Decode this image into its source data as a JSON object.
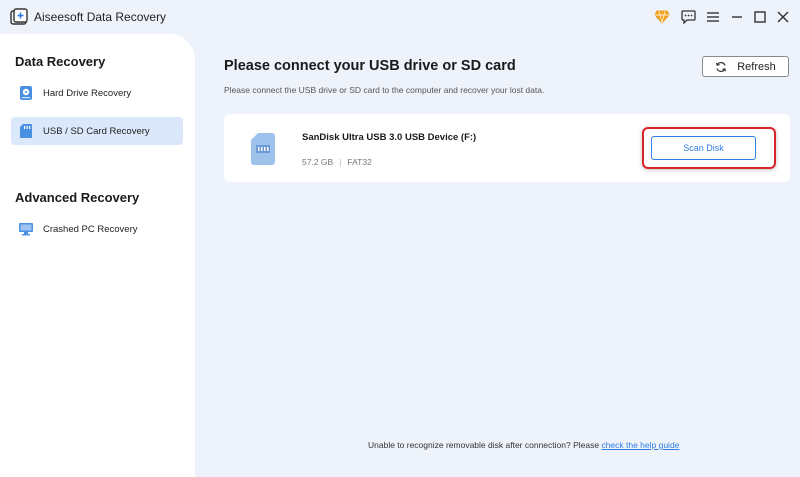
{
  "titlebar": {
    "app_title": "Aiseesoft Data Recovery",
    "icons": [
      "app-logo-icon",
      "diamond-icon",
      "feedback-icon",
      "menu-icon",
      "minimize-icon",
      "maximize-icon",
      "close-icon"
    ]
  },
  "sidebar": {
    "section1_title": "Data Recovery",
    "items": [
      {
        "label": "Hard Drive Recovery",
        "icon": "hard-drive-icon"
      },
      {
        "label": "USB / SD Card Recovery",
        "icon": "sd-card-icon",
        "active": true
      }
    ],
    "section2_title": "Advanced Recovery",
    "items2": [
      {
        "label": "Crashed PC Recovery",
        "icon": "pc-icon"
      }
    ]
  },
  "main": {
    "title": "Please connect your USB drive or SD card",
    "subtitle": "Please connect the USB drive or SD card to the computer and recover your lost data.",
    "refresh_label": "Refresh",
    "device": {
      "name": "SanDisk Ultra USB 3.0 USB Device (F:)",
      "size": "57.2 GB",
      "filesystem": "FAT32",
      "scan_label": "Scan Disk"
    },
    "footer_text": "Unable to recognize removable disk after connection? Please ",
    "footer_link": "check the help guide"
  },
  "colors": {
    "accent": "#2f7de1",
    "highlight": "#d9242a",
    "active_bg": "#dbe7fa",
    "page_bg": "#eef3fb"
  }
}
